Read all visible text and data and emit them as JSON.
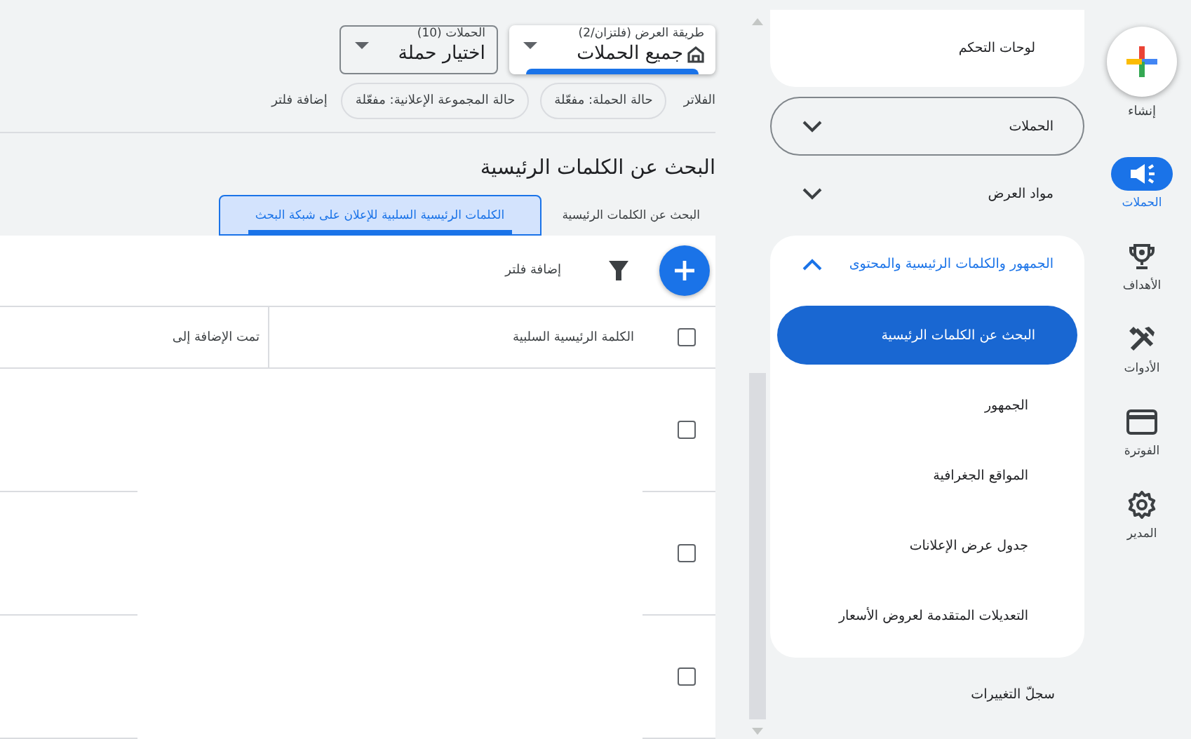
{
  "rail": {
    "create": {
      "label": "إنشاء"
    },
    "items": [
      {
        "label": "الحملات",
        "selected": true
      },
      {
        "label": "الأهداف",
        "selected": false
      },
      {
        "label": "الأدوات",
        "selected": false
      },
      {
        "label": "الفوترة",
        "selected": false
      },
      {
        "label": "المدير",
        "selected": false
      }
    ]
  },
  "sidebar": {
    "items": [
      {
        "kind": "card",
        "label": "لوحات التحكم"
      },
      {
        "kind": "group",
        "label": "الحملات",
        "expanded": false,
        "focused": true
      },
      {
        "kind": "group",
        "label": "مواد العرض",
        "expanded": false,
        "focused": false
      },
      {
        "kind": "group",
        "label": "الجمهور والكلمات الرئيسية والمحتوى",
        "expanded": true,
        "focused": false,
        "children": [
          {
            "label": "البحث عن الكلمات الرئيسية",
            "selected": true
          },
          {
            "label": "الجمهور",
            "selected": false
          },
          {
            "label": "المواقع الجغرافية",
            "selected": false
          },
          {
            "label": "جدول عرض الإعلانات",
            "selected": false
          },
          {
            "label": "التعديلات المتقدمة لعروض الأسعار",
            "selected": false
          }
        ]
      },
      {
        "kind": "link",
        "label": "سجلّ التغييرات"
      }
    ]
  },
  "header": {
    "view_selector": {
      "label": "طريقة العرض (فلتزان/2)",
      "value": "جميع الحملات"
    },
    "campaign_selector": {
      "label": "الحملات (10)",
      "value": "اختيار حملة"
    },
    "filters": {
      "label": "الفلاتر",
      "chips": [
        "حالة الحملة: مفعّلة",
        "حالة المجموعة الإعلانية: مفعّلة"
      ],
      "add": "إضافة فلتر"
    }
  },
  "page_title": "البحث عن الكلمات الرئيسية",
  "tabs": [
    {
      "label": "البحث عن الكلمات الرئيسية",
      "selected": false
    },
    {
      "label": "الكلمات الرئيسية السلبية للإعلان على شبكة البحث",
      "selected": true
    }
  ],
  "toolbar": {
    "add_filter": "إضافة فلتر"
  },
  "table": {
    "header_checked": false,
    "columns": [
      "الكلمة الرئيسية السلبية",
      "تمت الإضافة إلى"
    ],
    "rows": [
      {
        "checked": false
      },
      {
        "checked": false
      },
      {
        "checked": false
      }
    ]
  }
}
